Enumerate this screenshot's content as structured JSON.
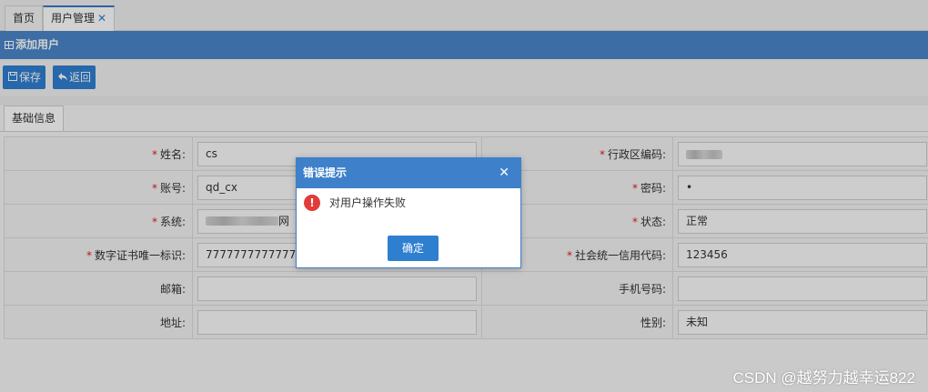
{
  "tabs": [
    {
      "label": "首页"
    },
    {
      "label": "用户管理",
      "close": "✕"
    }
  ],
  "title": "添加用户",
  "toolbar": {
    "save_label": "保存",
    "back_label": "返回"
  },
  "subtab": "基础信息",
  "form": {
    "name": {
      "label": "姓名:",
      "value": "cs"
    },
    "region_code": {
      "label": "行政区编码:"
    },
    "account": {
      "label": "账号:",
      "value": "qd_cx"
    },
    "password": {
      "label": "密码:",
      "value": "•"
    },
    "system": {
      "label": "系统:",
      "value_suffix": "网"
    },
    "status": {
      "label": "状态:",
      "value": "正常"
    },
    "cert_id": {
      "label": "数字证书唯一标识:",
      "value": "7777777777777777"
    },
    "credit_code": {
      "label": "社会统一信用代码:",
      "value": "123456"
    },
    "email": {
      "label": "邮箱:",
      "value": ""
    },
    "phone": {
      "label": "手机号码:",
      "value": ""
    },
    "address": {
      "label": "地址:",
      "value": ""
    },
    "gender": {
      "label": "性别:",
      "value": "未知"
    }
  },
  "required_mark": "*",
  "dialog": {
    "title": "错误提示",
    "close": "✕",
    "icon": "!",
    "message": "对用户操作失败",
    "ok_label": "确定"
  },
  "watermark": "CSDN @越努力越幸运822",
  "colors": {
    "header_blue": "#4a86c8",
    "button_blue": "#2f7fd1",
    "error_red": "#e33b3b",
    "required_red": "#e02020"
  }
}
